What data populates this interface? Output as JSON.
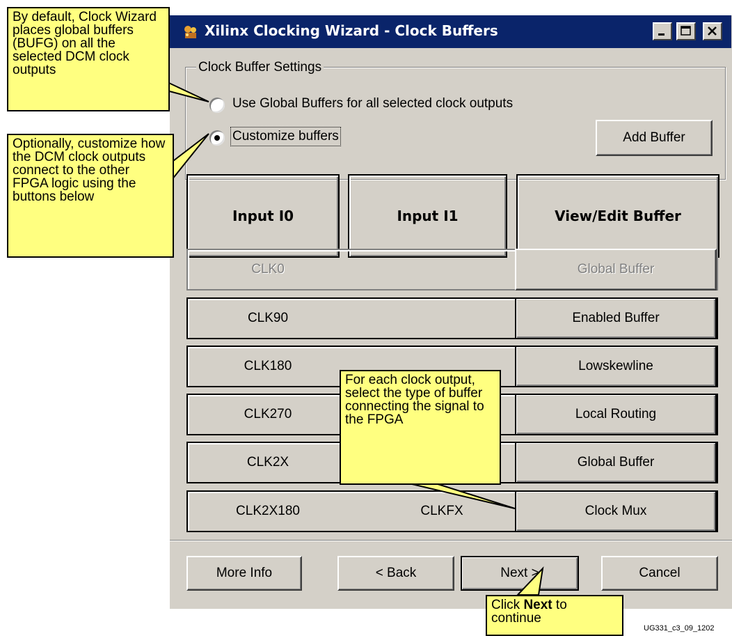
{
  "window": {
    "title": "Xilinx Clocking Wizard - Clock Buffers",
    "icon": "wizard-icon",
    "controls": [
      "minimize-icon",
      "maximize-icon",
      "close-icon"
    ]
  },
  "settings": {
    "group_label": "Clock Buffer Settings",
    "option_global": "Use Global Buffers for all selected clock outputs",
    "option_custom": "Customize buffers",
    "selected": "custom",
    "add_buffer_label": "Add Buffer"
  },
  "table": {
    "headers": [
      "Input I0",
      "Input I1",
      "View/Edit Buffer"
    ],
    "rows": [
      {
        "i0": "CLK0",
        "i1": "",
        "buffer": "Global Buffer",
        "disabled": true
      },
      {
        "i0": "CLK90",
        "i1": "",
        "buffer": "Enabled Buffer",
        "disabled": false
      },
      {
        "i0": "CLK180",
        "i1": "",
        "buffer": "Lowskewline",
        "disabled": false
      },
      {
        "i0": "CLK270",
        "i1": "",
        "buffer": "Local Routing",
        "disabled": false
      },
      {
        "i0": "CLK2X",
        "i1": "",
        "buffer": "Global Buffer",
        "disabled": false
      },
      {
        "i0": "CLK2X180",
        "i1": "CLKFX",
        "buffer": "Clock Mux",
        "disabled": false
      }
    ]
  },
  "footer": {
    "more_info": "More Info",
    "back": "< Back",
    "next": "Next >",
    "cancel": "Cancel"
  },
  "callouts": {
    "default": "By default, Clock Wizard places global buffers (BUFG) on all the selected DCM clock outputs",
    "optional": "Optionally, customize how the DCM clock outputs connect to the other FPGA logic using the buttons below",
    "each": "For each clock output, select the type of buffer connecting the signal to the FPGA",
    "next_prefix": "Click ",
    "next_bold": "Next",
    "next_suffix": " to continue"
  },
  "figure_id": "UG331_c3_09_1202",
  "colors": {
    "titlebar": "#0a246a",
    "dialog": "#d4d0c8",
    "callout": "#ffff80"
  }
}
